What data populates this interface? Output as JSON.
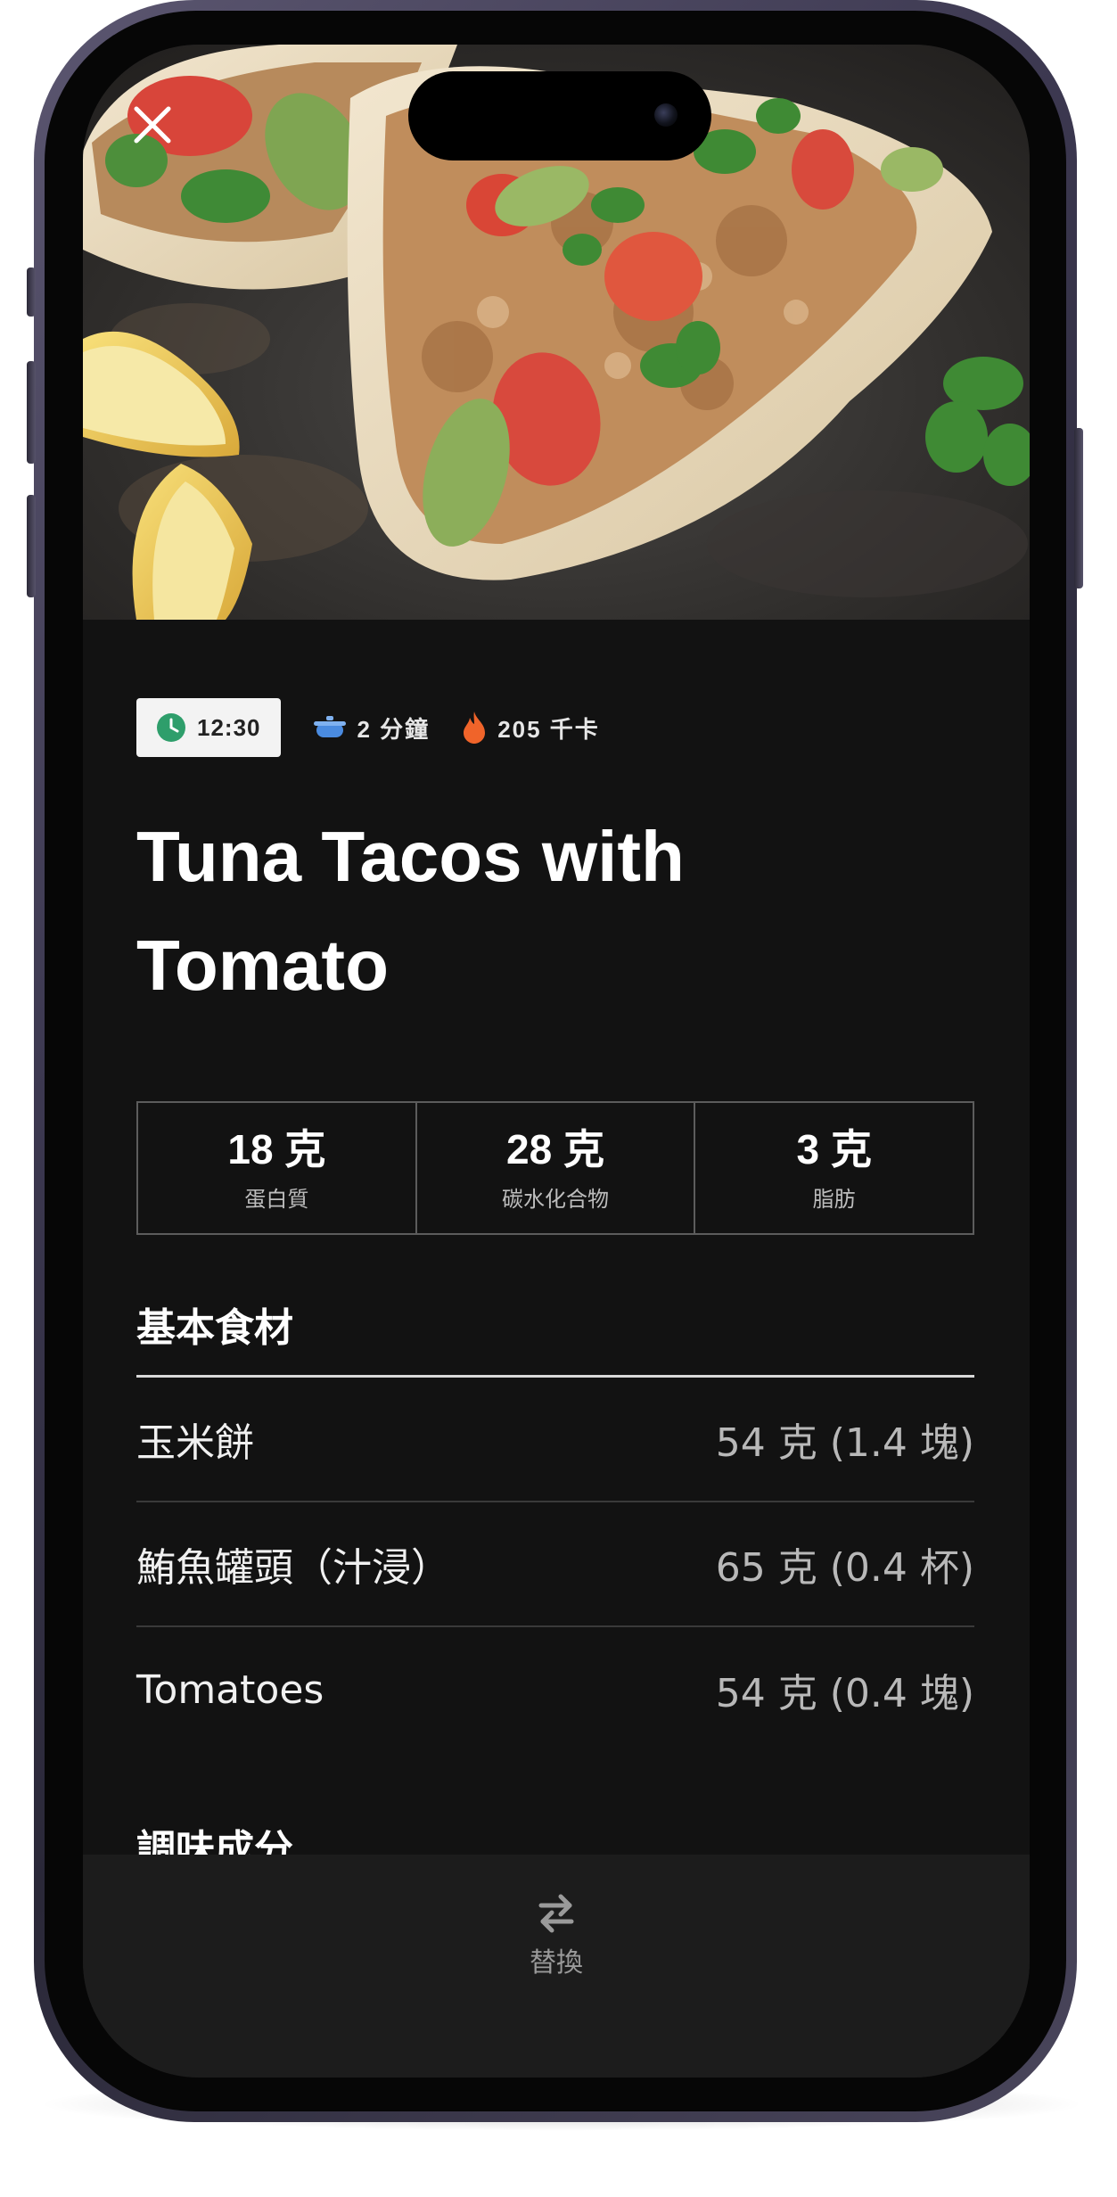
{
  "meta": {
    "time": "12:30",
    "cook_time": "2 分鐘",
    "calories": "205 千卡"
  },
  "recipe": {
    "title_line1": "Tuna Tacos with",
    "title_line2": "Tomato"
  },
  "macros": [
    {
      "value": "18 克",
      "label": "蛋白質"
    },
    {
      "value": "28 克",
      "label": "碳水化合物"
    },
    {
      "value": "3 克",
      "label": "脂肪"
    }
  ],
  "sections": {
    "basic": {
      "title": "基本食材",
      "items": [
        {
          "name": "玉米餅",
          "amount": "54 克 (1.4 塊)"
        },
        {
          "name": "鮪魚罐頭（汁浸）",
          "amount": "65 克 (0.4 杯)"
        },
        {
          "name": "Tomatoes",
          "amount": "54 克 (0.4 塊)"
        }
      ]
    },
    "seasoning": {
      "title": "調味成分"
    }
  },
  "bottom_bar": {
    "swap_label": "替換"
  },
  "colors": {
    "background": "#121212",
    "clock_accent": "#2e9e6b",
    "pot_accent": "#4a8be0",
    "flame_accent": "#f0642a"
  },
  "icons": [
    "close-icon",
    "clock-icon",
    "pot-icon",
    "flame-icon",
    "swap-icon"
  ]
}
